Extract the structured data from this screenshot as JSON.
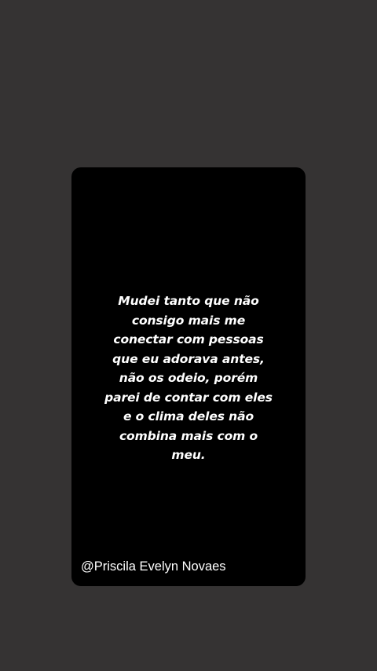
{
  "story": {
    "quote": "Mudei tanto que não\nconsigo mais me\nconectar com pessoas\nque eu adorava antes,\nnão os odeio, porém\nparei de contar com eles\ne o clima deles não\ncombina mais com o\nmeu.",
    "author": "@Priscila Evelyn Novaes"
  },
  "colors": {
    "background": "#353333",
    "card": "#000000",
    "text": "#ffffff"
  }
}
